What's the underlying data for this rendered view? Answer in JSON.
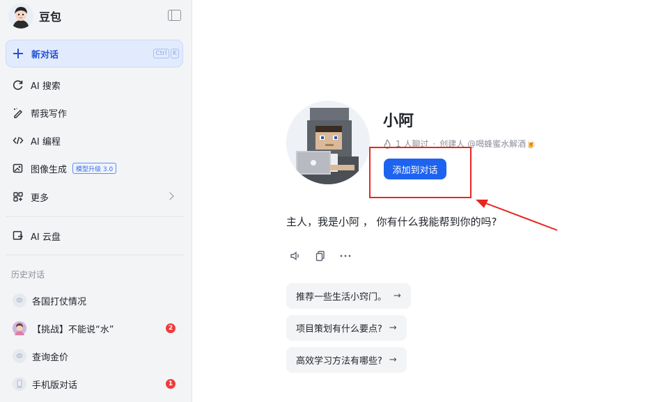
{
  "brand": {
    "name": "豆包"
  },
  "new_chat": {
    "label": "新对话",
    "shortcut_ctrl": "Ctrl",
    "shortcut_key": "K"
  },
  "nav": {
    "items": [
      {
        "label": "AI 搜索",
        "icon": "search-refresh-icon"
      },
      {
        "label": "帮我写作",
        "icon": "pen-icon"
      },
      {
        "label": "AI 编程",
        "icon": "code-icon"
      },
      {
        "label": "图像生成",
        "icon": "image-icon",
        "badge": "模型升级 3.0"
      },
      {
        "label": "更多",
        "icon": "grid-icon"
      }
    ],
    "cloud": {
      "label": "AI 云盘",
      "icon": "cloud-drive-icon"
    }
  },
  "history": {
    "title": "历史对话",
    "items": [
      {
        "label": "各国打仗情况",
        "icon": "chat-bubble-icon"
      },
      {
        "label": "【挑战】不能说“水”",
        "icon": "avatar-icon",
        "badge": "2"
      },
      {
        "label": "查询金价",
        "icon": "chat-bubble-icon"
      },
      {
        "label": "手机版对话",
        "icon": "phone-icon",
        "badge": "1"
      }
    ]
  },
  "bot": {
    "name": "小阿",
    "chat_count": "1 人聊过",
    "separator": "·",
    "creator": "创建人 @喝蜂蜜水解酒🍺",
    "add_button": "添加到对话",
    "greeting": "主人，我是小阿 ，  你有什么我能帮到你的吗?"
  },
  "suggestions": [
    "推荐一些生活小窍门。",
    "项目策划有什么要点?",
    "高效学习方法有哪些?"
  ],
  "suggestion_arrow": "→",
  "colors": {
    "accent": "#1d63f0",
    "highlight_box": "#e8261f",
    "sidebar_bg": "#f3f4f6",
    "new_chat_bg": "#e2ebfd"
  }
}
